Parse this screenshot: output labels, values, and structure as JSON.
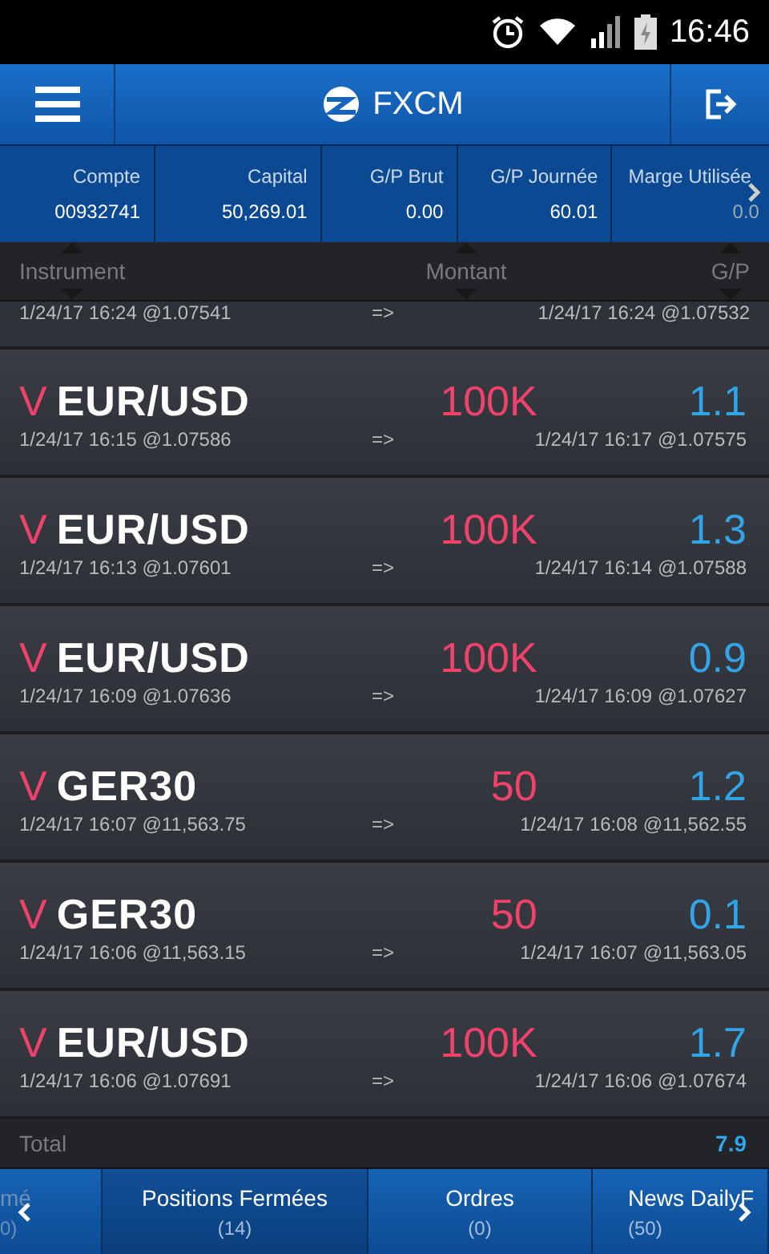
{
  "status_bar": {
    "time": "16:46"
  },
  "header": {
    "title": "FXCM"
  },
  "summary": [
    {
      "label": "Compte",
      "value": "00932741"
    },
    {
      "label": "Capital",
      "value": "50,269.01"
    },
    {
      "label": "G/P Brut",
      "value": "0.00"
    },
    {
      "label": "G/P Journée",
      "value": "60.01"
    },
    {
      "label": "Marge Utilisée",
      "value": "0.0"
    }
  ],
  "columns": [
    "Instrument",
    "Montant",
    "G/P"
  ],
  "partial_row": {
    "open": "1/24/17 16:24 @1.07541",
    "arrow": "=>",
    "close": "1/24/17 16:24 @1.07532"
  },
  "rows": [
    {
      "side": "V",
      "instrument": "EUR/USD",
      "amount": "100K",
      "pl": "1.1",
      "open": "1/24/17 16:15 @1.07586",
      "arrow": "=>",
      "close": "1/24/17 16:17 @1.07575"
    },
    {
      "side": "V",
      "instrument": "EUR/USD",
      "amount": "100K",
      "pl": "1.3",
      "open": "1/24/17 16:13 @1.07601",
      "arrow": "=>",
      "close": "1/24/17 16:14 @1.07588"
    },
    {
      "side": "V",
      "instrument": "EUR/USD",
      "amount": "100K",
      "pl": "0.9",
      "open": "1/24/17 16:09 @1.07636",
      "arrow": "=>",
      "close": "1/24/17 16:09 @1.07627"
    },
    {
      "side": "V",
      "instrument": "GER30",
      "amount": "50",
      "pl": "1.2",
      "open": "1/24/17 16:07 @11,563.75",
      "arrow": "=>",
      "close": "1/24/17 16:08 @11,562.55"
    },
    {
      "side": "V",
      "instrument": "GER30",
      "amount": "50",
      "pl": "0.1",
      "open": "1/24/17 16:06 @11,563.15",
      "arrow": "=>",
      "close": "1/24/17 16:07 @11,563.05"
    },
    {
      "side": "V",
      "instrument": "EUR/USD",
      "amount": "100K",
      "pl": "1.7",
      "open": "1/24/17 16:06 @1.07691",
      "arrow": "=>",
      "close": "1/24/17 16:06 @1.07674"
    }
  ],
  "total": {
    "label": "Total",
    "value": "7.9"
  },
  "tabs": [
    {
      "label": "mé",
      "count": "0)",
      "selected": false
    },
    {
      "label": "Positions Fermées",
      "count": "(14)",
      "selected": true
    },
    {
      "label": "Ordres",
      "count": "(0)",
      "selected": false
    },
    {
      "label": "News DailyF",
      "count": "(50)",
      "selected": false
    }
  ]
}
